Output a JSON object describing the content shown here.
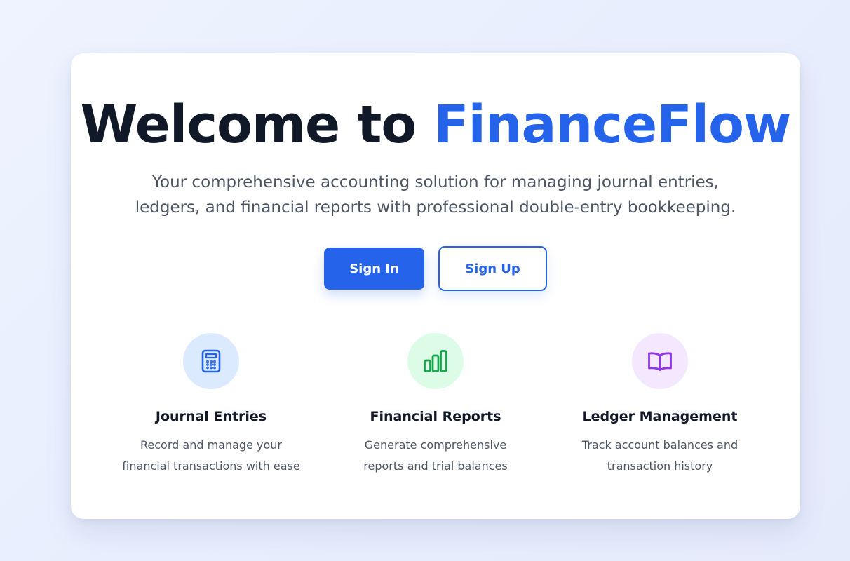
{
  "hero": {
    "title_prefix": "Welcome to ",
    "title_brand": "FinanceFlow",
    "subtitle_line1": "Your comprehensive accounting solution for managing journal entries,",
    "subtitle_line2": "ledgers, and financial reports with professional double-entry bookkeeping."
  },
  "actions": {
    "sign_in_label": "Sign In",
    "sign_up_label": "Sign Up"
  },
  "features": [
    {
      "icon": "calculator-icon",
      "title": "Journal Entries",
      "desc_line1": "Record and manage your",
      "desc_line2": "financial transactions with ease"
    },
    {
      "icon": "bar-chart-icon",
      "title": "Financial Reports",
      "desc_line1": "Generate comprehensive",
      "desc_line2": "reports and trial balances"
    },
    {
      "icon": "open-book-icon",
      "title": "Ledger Management",
      "desc_line1": "Track account balances and",
      "desc_line2": "transaction history"
    }
  ],
  "colors": {
    "brand": "#2563eb",
    "heading": "#111827",
    "body_text": "#4b5563",
    "icon_blue": "#2563eb",
    "icon_green": "#16a34a",
    "icon_purple": "#9333ea"
  }
}
